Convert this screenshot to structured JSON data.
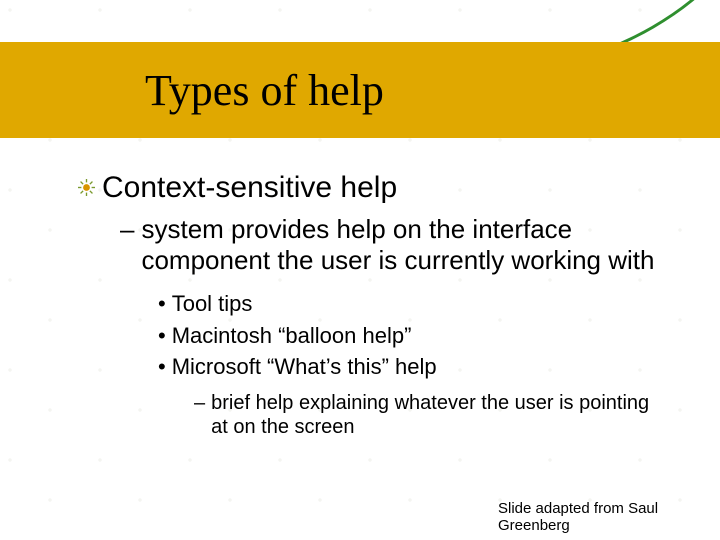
{
  "title": "Types of help",
  "level1": {
    "heading": "Context-sensitive help"
  },
  "level2": {
    "dash": "–",
    "text": "system provides help on the interface component the user is currently working with"
  },
  "level3": {
    "items": [
      "Tool tips",
      "Macintosh “balloon help”",
      "Microsoft “What’s this” help"
    ],
    "bullet": "•"
  },
  "level4": {
    "dash": "–",
    "text": "brief help explaining whatever the user is pointing at on the screen"
  },
  "footer": "Slide adapted from Saul Greenberg"
}
